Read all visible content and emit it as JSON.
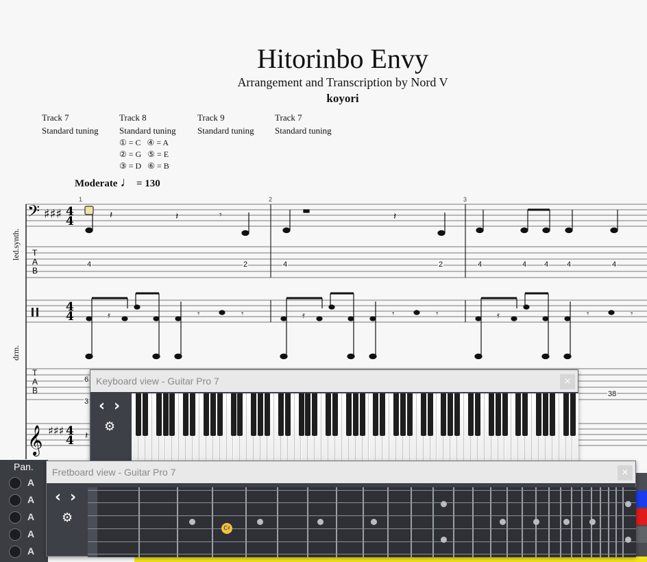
{
  "score": {
    "title": "Hitorinbo Envy",
    "subtitle": "Arrangement and Transcription by Nord V",
    "artist": "koyori",
    "tracks": [
      {
        "name": "Track 7",
        "tuning": "Standard tuning"
      },
      {
        "name": "Track 8",
        "tuning": "Standard tuning"
      },
      {
        "name": "Track 9",
        "tuning": "Standard tuning"
      },
      {
        "name": "Track 7",
        "tuning": "Standard tuning"
      }
    ],
    "string_tuning": [
      {
        "num": "①",
        "note": "= C"
      },
      {
        "num": "④",
        "note": "= A"
      },
      {
        "num": "②",
        "note": "= G"
      },
      {
        "num": "⑤",
        "note": "= E"
      },
      {
        "num": "③",
        "note": "= D"
      },
      {
        "num": "⑥",
        "note": "= B"
      }
    ],
    "tempo_label": "Moderate",
    "tempo_note": "♩",
    "tempo_value": "= 130",
    "instruments": [
      "led.synth.",
      "drm."
    ],
    "measure_numbers": [
      "1",
      "2",
      "3"
    ],
    "time_sig": "4",
    "tab_label": [
      "T",
      "A",
      "B"
    ],
    "tab_numbers_bass": [
      "4",
      "2",
      "4",
      "2",
      "4",
      "4",
      "4",
      "4",
      "4"
    ],
    "tab_numbers_drum": [
      "6",
      "3",
      "38"
    ]
  },
  "keyboard_view": {
    "title": "Keyboard view - Guitar Pro 7",
    "close": "×",
    "highlighted_note": "C♯",
    "nav_prev": "‹",
    "nav_next": "›",
    "settings_icon": "⚙"
  },
  "fretboard_view": {
    "title": "Fretboard view - Guitar Pro 7",
    "close": "×",
    "highlighted_note": "C♯",
    "nav_prev": "‹",
    "nav_next": "›",
    "settings_icon": "⚙"
  },
  "mixer": {
    "pan_label": "Pan.",
    "rows": [
      "A",
      "A",
      "A",
      "A",
      "A"
    ],
    "accent": "#f0c040"
  }
}
